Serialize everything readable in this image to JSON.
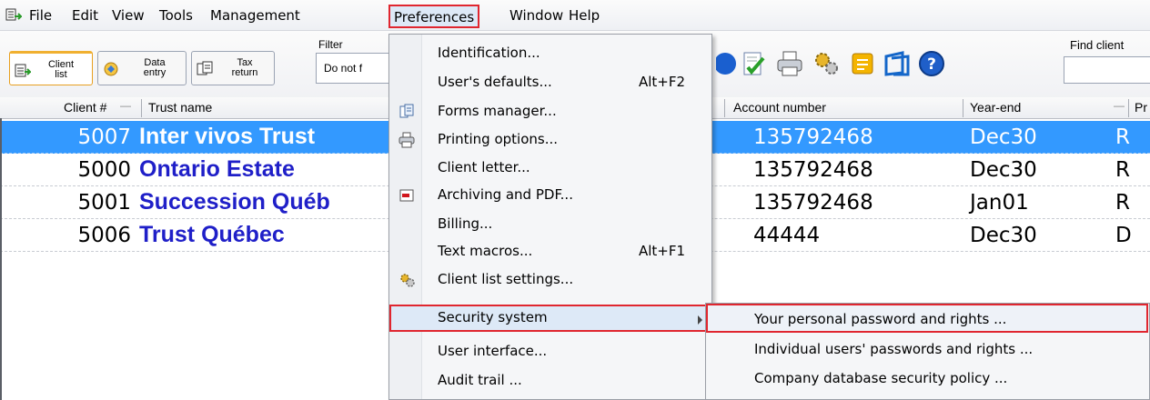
{
  "menubar": {
    "items": [
      "File",
      "Edit",
      "View",
      "Tools",
      "Management",
      "Preferences",
      "Window",
      "Help"
    ]
  },
  "toolbar": {
    "tabs": [
      {
        "line1": "Client",
        "line2": "list"
      },
      {
        "line1": "Data",
        "line2": "entry"
      },
      {
        "line1": "Tax",
        "line2": "return"
      }
    ],
    "filter_label": "Filter",
    "filter_value": "Do not f",
    "find_label": "Find client",
    "icons": [
      "globe-icon",
      "edit-check-icon",
      "printer-icon",
      "gears-icon",
      "note-icon",
      "window-icon",
      "help-icon"
    ]
  },
  "columns": {
    "client_num": "Client #",
    "trust_name": "Trust name",
    "account_number": "Account number",
    "year_end": "Year-end",
    "pr": "Pr"
  },
  "rows": [
    {
      "num": "5007",
      "name": "Inter vivos Trust",
      "account": "135792468",
      "year_end": "Dec30",
      "pr": "R"
    },
    {
      "num": "5000",
      "name": "Ontario Estate",
      "account": "135792468",
      "year_end": "Dec30",
      "pr": "R"
    },
    {
      "num": "5001",
      "name": "Succession Québ",
      "account": "135792468",
      "year_end": "Jan01",
      "pr": "R"
    },
    {
      "num": "5006",
      "name": "Trust Québec",
      "account": "44444",
      "year_end": "Dec30",
      "pr": "D"
    }
  ],
  "preferences_menu": [
    {
      "label": "Identification...",
      "shortcut": ""
    },
    {
      "label": "User's defaults...",
      "shortcut": "Alt+F2"
    },
    {
      "label": "Forms manager...",
      "shortcut": ""
    },
    {
      "label": "Printing options...",
      "shortcut": ""
    },
    {
      "label": "Client letter...",
      "shortcut": ""
    },
    {
      "label": "Archiving and PDF...",
      "shortcut": ""
    },
    {
      "label": "Billing...",
      "shortcut": ""
    },
    {
      "label": "Text macros...",
      "shortcut": "Alt+F1"
    },
    {
      "label": "Client list settings...",
      "shortcut": ""
    },
    {
      "label": "Security system",
      "shortcut": ""
    },
    {
      "label": "User interface...",
      "shortcut": ""
    },
    {
      "label": "Audit trail ...",
      "shortcut": ""
    }
  ],
  "security_submenu": [
    {
      "label": "Your personal password and rights ..."
    },
    {
      "label": "Individual users' passwords and rights ..."
    },
    {
      "label": "Company database security policy ..."
    }
  ],
  "colors": {
    "selection": "#3399ff",
    "client_name": "#1f1fc8",
    "highlight_border": "#e0262f"
  }
}
